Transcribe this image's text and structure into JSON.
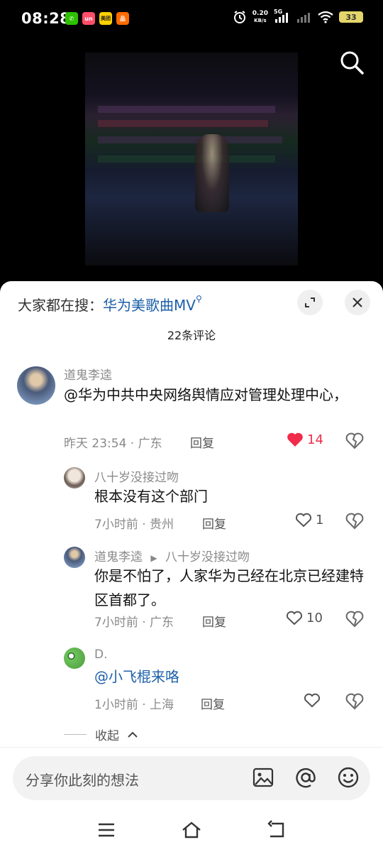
{
  "status_bar": {
    "time": "08:28",
    "speed_value": "0.20",
    "speed_unit": "KB/s",
    "network": "5G",
    "battery": "33",
    "app_icons": [
      {
        "name": "wechat-icon",
        "color": "#2dc100",
        "glyph": "✆"
      },
      {
        "name": "shopping-icon",
        "color": "#ff4d6a",
        "glyph": "un"
      },
      {
        "name": "meituan-icon",
        "color": "#ffd000",
        "glyph": "美团"
      },
      {
        "name": "app-icon",
        "color": "#ff6a00",
        "glyph": "品"
      }
    ]
  },
  "trending": {
    "label": "大家都在搜：",
    "query": "华为美歌曲MV"
  },
  "comment_count": "22条评论",
  "comments": [
    {
      "user": "道鬼李逵",
      "text": "@华为中共中央网络舆情应对管理处理中心，",
      "time_location": "昨天 23:54 · 广东",
      "reply_label": "回复",
      "likes": "14",
      "liked": true
    },
    {
      "user": "八十岁没接过吻",
      "text": "根本没有这个部门",
      "time_location": "7小时前 · 贵州",
      "reply_label": "回复",
      "likes": "1",
      "liked": false
    },
    {
      "user": "道鬼李逵",
      "reply_to": "八十岁没接过吻",
      "text": "你是不怕了，人家华为己经在北京已经建特区首都了。",
      "time_location": "7小时前 · 广东",
      "reply_label": "回复",
      "likes": "10",
      "liked": false
    },
    {
      "user": "D.",
      "text": "@小飞棍来咯",
      "time_location": "1小时前 · 上海",
      "reply_label": "回复",
      "likes": "",
      "liked": false
    }
  ],
  "collapse_label": "收起",
  "input": {
    "placeholder": "分享你此刻的想法"
  },
  "colors": {
    "accent_blue": "#1c5fa8",
    "like_red": "#f02c4a"
  }
}
